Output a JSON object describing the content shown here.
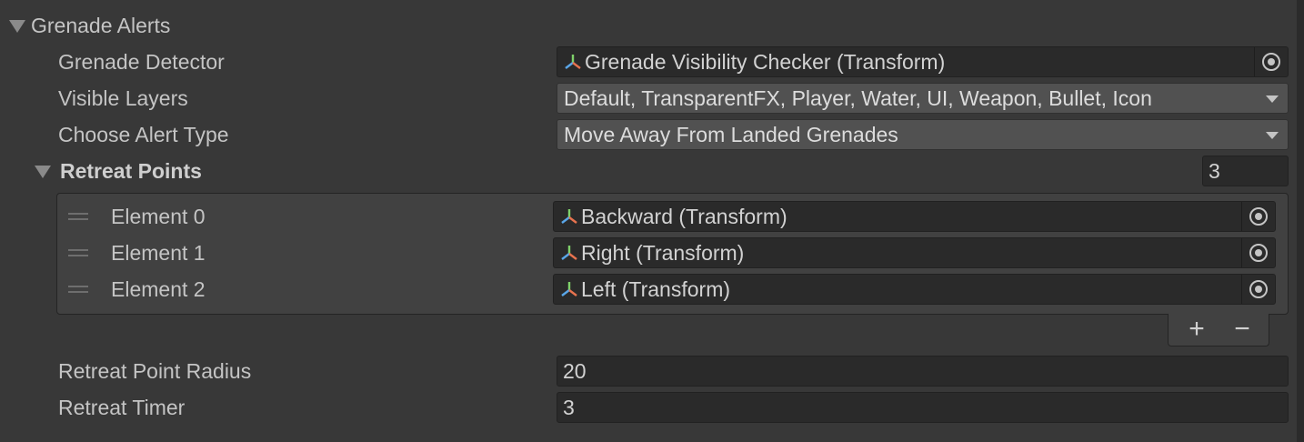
{
  "section": {
    "title": "Grenade Alerts"
  },
  "grenade_detector": {
    "label": "Grenade Detector",
    "value": "Grenade Visibility Checker (Transform)",
    "icon": "transform-icon"
  },
  "visible_layers": {
    "label": "Visible Layers",
    "value": "Default, TransparentFX, Player, Water, UI, Weapon, Bullet, Icon"
  },
  "alert_type": {
    "label": "Choose Alert Type",
    "value": "Move Away From Landed Grenades"
  },
  "retreat_points": {
    "label": "Retreat Points",
    "size": "3",
    "elements": [
      {
        "label": "Element 0",
        "value": "Backward (Transform)"
      },
      {
        "label": "Element 1",
        "value": "Right (Transform)"
      },
      {
        "label": "Element 2",
        "value": "Left (Transform)"
      }
    ],
    "add_label": "+",
    "remove_label": "−"
  },
  "retreat_point_radius": {
    "label": "Retreat Point Radius",
    "value": "20"
  },
  "retreat_timer": {
    "label": "Retreat Timer",
    "value": "3"
  },
  "colors": {
    "background": "#383838",
    "field": "#2a2a2a",
    "dropdown": "#515151",
    "list_background": "#414141",
    "text": "#c4c4c4"
  }
}
